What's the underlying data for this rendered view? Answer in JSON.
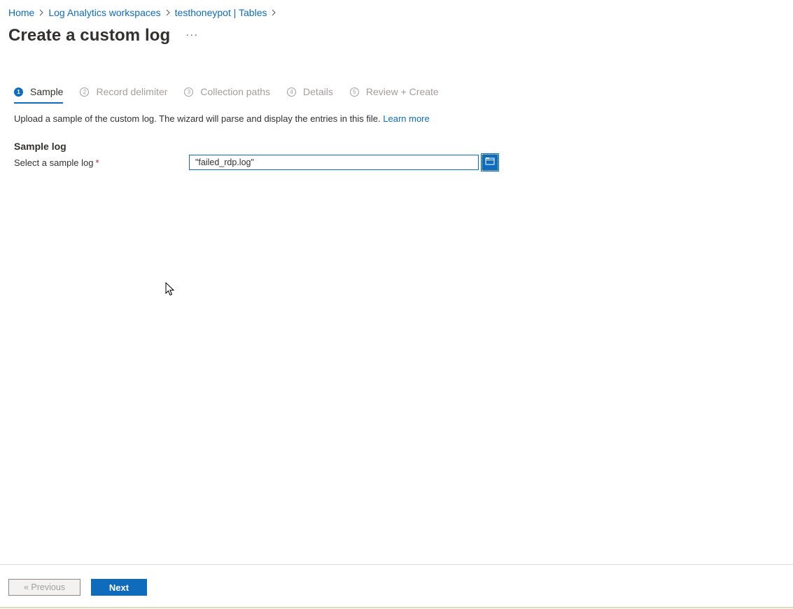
{
  "breadcrumb": {
    "items": [
      {
        "label": "Home"
      },
      {
        "label": "Log Analytics workspaces"
      },
      {
        "label": "testhoneypot | Tables"
      }
    ]
  },
  "header": {
    "title": "Create a custom log",
    "more_label": "···"
  },
  "tabs": [
    {
      "number": "1",
      "label": "Sample",
      "active": true
    },
    {
      "number": "2",
      "label": "Record delimiter",
      "active": false
    },
    {
      "number": "3",
      "label": "Collection paths",
      "active": false
    },
    {
      "number": "4",
      "label": "Details",
      "active": false
    },
    {
      "number": "5",
      "label": "Review + Create",
      "active": false
    }
  ],
  "main": {
    "description": "Upload a sample of the custom log. The wizard will parse and display the entries in this file.",
    "learn_more": "Learn more",
    "section_title": "Sample log",
    "field_label": "Select a sample log",
    "required_marker": "*",
    "file_value": "\"failed_rdp.log\""
  },
  "footer": {
    "previous_label": "« Previous",
    "next_label": "Next"
  },
  "colors": {
    "accent": "#0f6cbd",
    "text": "#323130",
    "disabled": "#a19f9d",
    "required": "#a4262c"
  },
  "icons": [
    "chevron-right-icon",
    "folder-open-icon",
    "mouse-pointer-icon"
  ]
}
